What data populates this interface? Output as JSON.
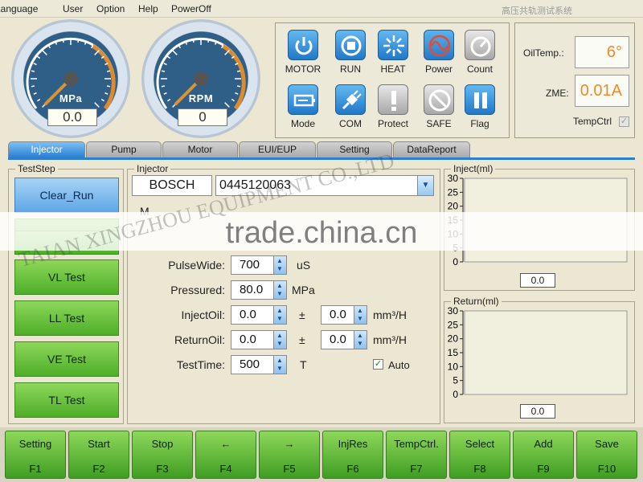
{
  "menu": [
    "Language",
    "User",
    "Option",
    "Help",
    "PowerOff"
  ],
  "app_title": "高压共轨测试系统",
  "gauges": [
    {
      "unit": "MPa",
      "value": "0.0",
      "needle_fraction": 0.0
    },
    {
      "unit": "RPM",
      "value": "0",
      "needle_fraction": 0.0
    }
  ],
  "controls": [
    {
      "label": "MOTOR",
      "icon": "power-icon"
    },
    {
      "label": "RUN",
      "icon": "stop-square-icon"
    },
    {
      "label": "HEAT",
      "icon": "heat-burst-icon"
    },
    {
      "label": "Power",
      "icon": "sine-wave-icon"
    },
    {
      "label": "Count",
      "icon": "dial-icon"
    },
    {
      "label": "Mode",
      "icon": "battery-mode-icon"
    },
    {
      "label": "COM",
      "icon": "plug-icon"
    },
    {
      "label": "Protect",
      "icon": "exclamation-icon"
    },
    {
      "label": "SAFE",
      "icon": "no-entry-icon"
    },
    {
      "label": "Flag",
      "icon": "pause-icon"
    }
  ],
  "readouts": {
    "oil_temp_label": "OilTemp.:",
    "oil_temp_value": "6°",
    "zme_label": "ZME:",
    "zme_value": "0.01A",
    "temp_ctrl_label": "TempCtrl"
  },
  "tabs": [
    "Injector",
    "Pump",
    "Motor",
    "EUI/EUP",
    "Setting",
    "DataReport"
  ],
  "active_tab": "Injector",
  "test_step": {
    "title": "TestStep",
    "items": [
      "Clear_Run",
      "",
      "",
      "VL Test",
      "LL Test",
      "VE Test",
      "TL Test"
    ]
  },
  "injector": {
    "title": "Injector",
    "brand": "BOSCH",
    "model": "0445120063",
    "partial_label": "M",
    "pulse_wide_label": "PulseWide:",
    "pulse_wide_value": "700",
    "pulse_wide_unit": "uS",
    "pressured_label": "Pressured:",
    "pressured_value": "80.0",
    "pressured_unit": "MPa",
    "inject_oil_label": "InjectOil:",
    "inject_oil_value": "0.0",
    "inject_oil_tol": "0.0",
    "return_oil_label": "ReturnOil:",
    "return_oil_value": "0.0",
    "return_oil_tol": "0.0",
    "pm": "±",
    "flow_unit": "mm³/H",
    "test_time_label": "TestTime:",
    "test_time_value": "500",
    "test_time_unit": "T",
    "auto_label": "Auto",
    "auto_checked": true
  },
  "chart_data": [
    {
      "type": "bar",
      "title": "Inject(ml)",
      "y_ticks": [
        0,
        5,
        10,
        15,
        20,
        25,
        30
      ],
      "ylim": [
        0,
        30
      ],
      "values": [],
      "readout": "0.0"
    },
    {
      "type": "bar",
      "title": "Return(ml)",
      "y_ticks": [
        0,
        5,
        10,
        15,
        20,
        25,
        30
      ],
      "ylim": [
        0,
        30
      ],
      "values": [],
      "readout": "0.0"
    }
  ],
  "function_keys": [
    {
      "label": "Setting",
      "key": "F1"
    },
    {
      "label": "Start",
      "key": "F2"
    },
    {
      "label": "Stop",
      "key": "F3"
    },
    {
      "label": "←",
      "key": "F4"
    },
    {
      "label": "→",
      "key": "F5"
    },
    {
      "label": "InjRes",
      "key": "F6"
    },
    {
      "label": "TempCtrl.",
      "key": "F7"
    },
    {
      "label": "Select",
      "key": "F8"
    },
    {
      "label": "Add",
      "key": "F9"
    },
    {
      "label": "Save",
      "key": "F10"
    }
  ],
  "watermark": {
    "main": "trade.china.cn",
    "diagonal": "TAIAN XINGZHOU EQUIPMENT CO.,LTD"
  },
  "colors": {
    "accent_blue": "#2a7fd2",
    "button_green": "#4eae28",
    "readout_orange": "#f08a24"
  }
}
